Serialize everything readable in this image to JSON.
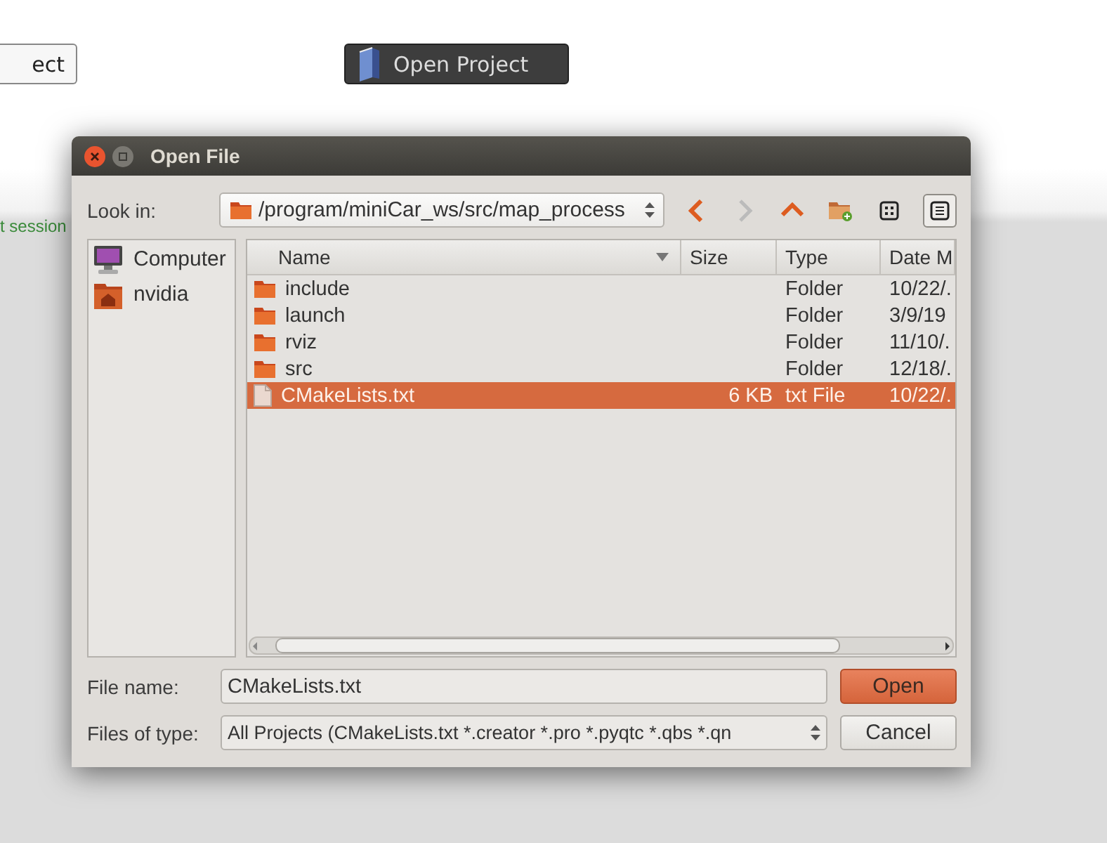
{
  "background": {
    "buttons": [
      {
        "label": "ect",
        "kind": "light"
      },
      {
        "label": "Open Project",
        "kind": "dark"
      }
    ],
    "status_text": "t session"
  },
  "dialog": {
    "title": "Open File",
    "look_in": {
      "label": "Look in:",
      "value": "/program/miniCar_ws/src/map_process"
    },
    "view_modes": [
      {
        "kind": "icons",
        "selected": false
      },
      {
        "kind": "detail",
        "selected": true
      }
    ],
    "sidebar": {
      "items": [
        {
          "label": "Computer",
          "kind": "computer"
        },
        {
          "label": "nvidia",
          "kind": "home"
        }
      ]
    },
    "table": {
      "columns": [
        "Name",
        "Size",
        "Type",
        "Date M"
      ],
      "rows": [
        {
          "kind": "folder",
          "name": "include",
          "type": "Folder",
          "date": "10/22/.",
          "selected": false
        },
        {
          "kind": "folder",
          "name": "launch",
          "type": "Folder",
          "date": "3/9/19",
          "selected": false
        },
        {
          "kind": "folder",
          "name": "rviz",
          "type": "Folder",
          "date": "11/10/.",
          "selected": false
        },
        {
          "kind": "folder",
          "name": "src",
          "type": "Folder",
          "date": "12/18/.",
          "selected": false
        },
        {
          "kind": "file",
          "name": "CMakeLists.txt",
          "size": "6 KB",
          "type": "txt File",
          "date": "10/22/.",
          "selected": true
        }
      ]
    },
    "file_name": {
      "label": "File name:",
      "value": "CMakeLists.txt"
    },
    "file_type": {
      "label": "Files of type:",
      "value": "All Projects (CMakeLists.txt *.creator *.pro *.pyqtc *.qbs *.qn"
    },
    "buttons": [
      {
        "label": "Open",
        "kind": "default"
      },
      {
        "label": "Cancel",
        "kind": "normal"
      }
    ]
  }
}
